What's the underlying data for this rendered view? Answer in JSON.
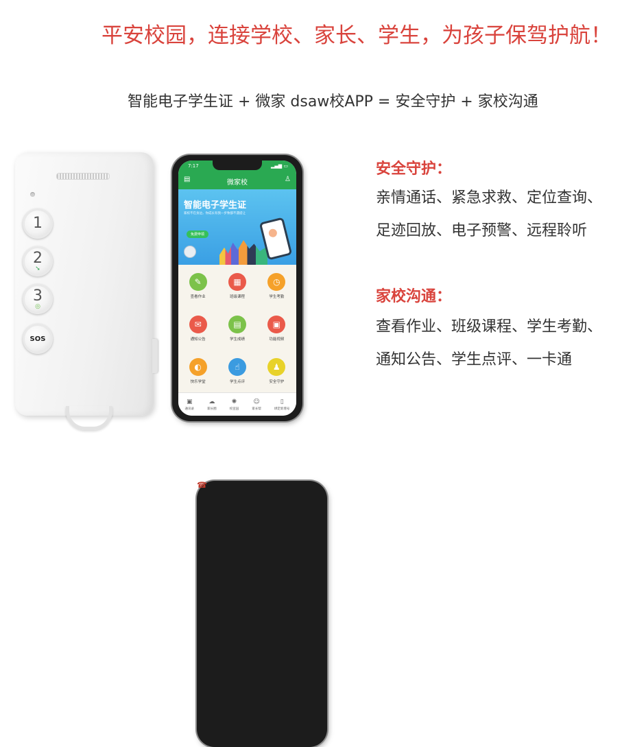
{
  "header": {
    "slogan": "平安校园，连接学校、家长、学生，为孩子保驾护航！",
    "formula": "智能电子学生证 + 微家 dsaw校APP = 安全守护 + 家校沟通"
  },
  "sections": [
    {
      "title": "安全守护：",
      "lines": [
        "亲情通话、紧急求救、定位查询、",
        "足迹回放、电子预警、远程聆听"
      ]
    },
    {
      "title": "家校沟通：",
      "lines": [
        "查看作业、班级课程、学生考勤、",
        "通知公告、学生点评、一卡通"
      ]
    }
  ],
  "device": {
    "buttons": [
      {
        "label": "1",
        "icon": "none-icon"
      },
      {
        "label": "2",
        "icon": "arrow-icon"
      },
      {
        "label": "3",
        "icon": "circle-icon"
      },
      {
        "label": "SOS",
        "icon": "phone-icon"
      }
    ]
  },
  "phone": {
    "status_time": "7:17",
    "app_title": "微家校",
    "banner": {
      "title": "智能电子学生证",
      "subtitle": "家校不在身边，你成长有我一步致都不遇提让",
      "button": "免费申领"
    },
    "grid_items": [
      {
        "label": "查看作业",
        "color": "#7cc24a",
        "icon": "pencil-icon",
        "glyph": "✎"
      },
      {
        "label": "班级课程",
        "color": "#ea5a4a",
        "icon": "calendar-icon",
        "glyph": "▦"
      },
      {
        "label": "学生考勤",
        "color": "#f5a12a",
        "icon": "clock-icon",
        "glyph": "◷"
      },
      {
        "label": "通知公告",
        "color": "#ea5a4a",
        "icon": "megaphone-icon",
        "glyph": "✉"
      },
      {
        "label": "学生成绩",
        "color": "#7cc24a",
        "icon": "document-icon",
        "glyph": "▤"
      },
      {
        "label": "功能视频",
        "color": "#ea5a4a",
        "icon": "tv-icon",
        "glyph": "▣"
      },
      {
        "label": "快乐学堂",
        "color": "#f5a12a",
        "icon": "cap-icon",
        "glyph": "◐"
      },
      {
        "label": "学生点评",
        "color": "#3b9be0",
        "icon": "thumbs-up-icon",
        "glyph": "☝"
      },
      {
        "label": "安全守护",
        "color": "#e8d22a",
        "icon": "user-shield-icon",
        "glyph": "♟"
      }
    ],
    "tabs": [
      {
        "label": "通讯录",
        "icon": "contacts-icon",
        "glyph": "▣"
      },
      {
        "label": "家长圈",
        "icon": "chat-icon",
        "glyph": "☁"
      },
      {
        "label": "校宣园",
        "icon": "atom-icon",
        "glyph": "✺"
      },
      {
        "label": "家长帮",
        "icon": "masks-icon",
        "glyph": "☺"
      },
      {
        "label": "绑定新增号",
        "icon": "phone-add-icon",
        "glyph": "▯"
      }
    ]
  }
}
